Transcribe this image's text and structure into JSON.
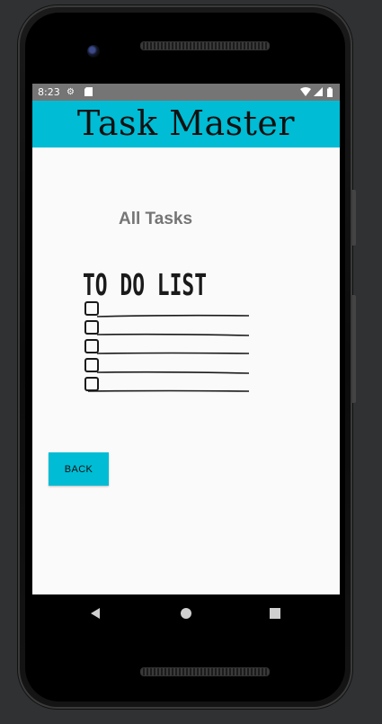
{
  "status_bar": {
    "time": "8:23",
    "icons": [
      "settings-icon",
      "sd-card-icon",
      "wifi-icon",
      "cell-signal-icon",
      "battery-icon"
    ]
  },
  "app_bar": {
    "title": "Task Master",
    "color": "#00bcd4"
  },
  "content": {
    "heading": "All Tasks",
    "image": {
      "title": "TO DO LIST",
      "checkbox_rows": 5
    },
    "back_button_label": "BACK"
  },
  "nav_bar": {
    "items": [
      "back-icon",
      "home-icon",
      "recents-icon"
    ]
  },
  "colors": {
    "accent": "#00bcd4",
    "status_bar": "#757575",
    "heading_text": "#757575",
    "screen_bg": "#fafafa"
  }
}
